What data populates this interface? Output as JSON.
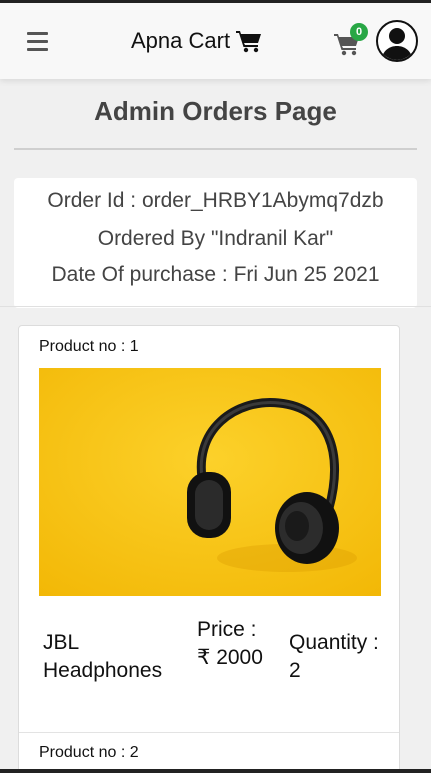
{
  "navbar": {
    "brand": "Apna Cart",
    "cart_count": "0",
    "icons": [
      "hamburger-menu-icon",
      "shopping-cart-icon",
      "user-avatar-icon"
    ]
  },
  "page": {
    "title": "Admin Orders Page"
  },
  "order": {
    "id_line": "Order Id : order_HRBY1Abymq7dzb",
    "ordered_by_line": "Ordered By \"Indranil Kar\"",
    "date_line": "Date Of purchase : Fri Jun 25 2021"
  },
  "products": [
    {
      "no_label": "Product no : 1",
      "name": "JBL Headphones",
      "price": "Price : ₹ 2000",
      "quantity": "Quantity : 2"
    },
    {
      "no_label": "Product no : 2"
    }
  ],
  "colors": {
    "navbar_bg": "#f8f8f8",
    "page_bg": "#f0f0f0",
    "badge": "#28a745",
    "image_bg": "#f5c214"
  }
}
